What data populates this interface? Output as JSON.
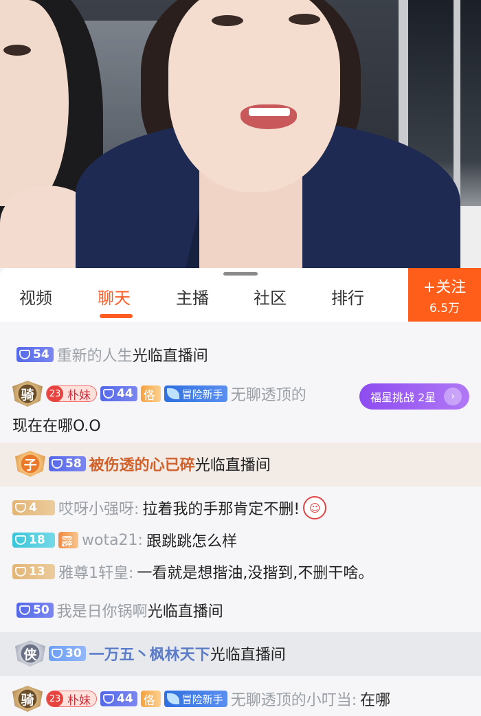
{
  "tabs": [
    {
      "label": "视频",
      "active": false
    },
    {
      "label": "聊天",
      "active": true
    },
    {
      "label": "主播",
      "active": false
    },
    {
      "label": "社区",
      "active": false
    },
    {
      "label": "排行",
      "active": false
    }
  ],
  "follow": {
    "label": "关注",
    "plus": "+",
    "count": "6.5万"
  },
  "challenge_pill": {
    "label": "福星挑战 2星",
    "icon": "chevron-icon"
  },
  "chat": {
    "m1": {
      "level": "54",
      "user": "重新的人生",
      "action": "光临直播间"
    },
    "m2": {
      "noble": "骑",
      "fan_level": "23",
      "fan_name": "朴妹",
      "level": "44",
      "title": "佫",
      "newbie": "冒险新手",
      "user": "无聊透顶的",
      "text": "现在在哪O.O"
    },
    "m3": {
      "noble": "子",
      "level": "58",
      "user": "被伤透的心已碎",
      "action": "光临直播间"
    },
    "m4": {
      "level": "4",
      "user": "哎呀小强呀:",
      "text": "拉着我的手那肯定不删!"
    },
    "m5": {
      "level": "18",
      "title": "霹",
      "user": "wota21:",
      "text": "跟跳跳怎么样"
    },
    "m6": {
      "level": "13",
      "user": "雅尊1轩皇:",
      "text": "一看就是想揩油,没揩到,不删干啥。"
    },
    "m7": {
      "level": "50",
      "user": "我是日你锅啊",
      "action": "光临直播间"
    },
    "m8": {
      "noble": "侠",
      "level": "30",
      "user": "一万五丶枫林天下",
      "action": "光临直播间"
    },
    "m9": {
      "noble": "骑",
      "fan_level": "23",
      "fan_name": "朴妹",
      "level": "44",
      "title": "佫",
      "newbie": "冒险新手",
      "user": "无聊透顶的小叮当:",
      "text": "在哪"
    }
  },
  "colors": {
    "accent": "#ff5d23",
    "follow_bg": "#ff5d1a",
    "pill": "#8d4cf0"
  }
}
